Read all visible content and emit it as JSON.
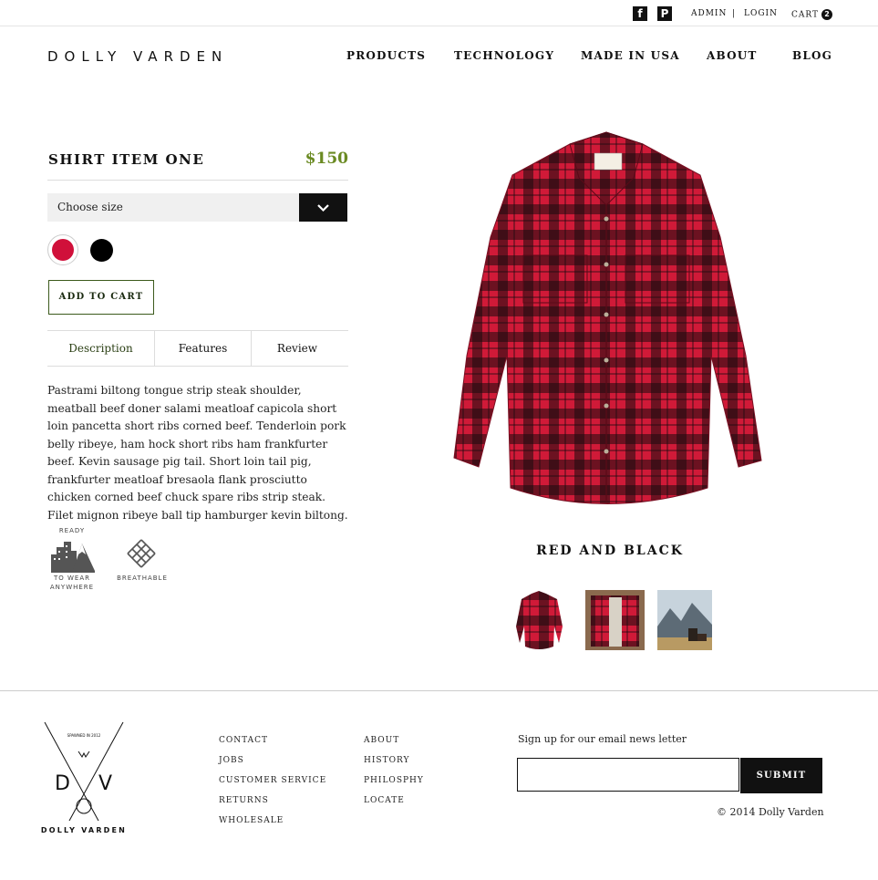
{
  "topbar": {
    "social": [
      {
        "name": "facebook",
        "glyph": "f"
      },
      {
        "name": "pinterest",
        "glyph": "P"
      }
    ],
    "admin": "ADMIN",
    "separator": "|",
    "login": "LOGIN",
    "cart": "CART",
    "cart_count": "2"
  },
  "header": {
    "brand": "DOLLY VARDEN",
    "nav": [
      "PRODUCTS",
      "TECHNOLOGY",
      "MADE IN USA",
      "ABOUT",
      "BLOG"
    ]
  },
  "product": {
    "title": "SHIRT ITEM ONE",
    "price": "$150",
    "size_placeholder": "Choose size",
    "swatches": [
      {
        "name": "red",
        "color": "#d0103a",
        "selected": true
      },
      {
        "name": "black",
        "color": "#000000",
        "selected": false
      }
    ],
    "add_to_cart": "ADD TO CART",
    "tabs": [
      "Description",
      "Features",
      "Review"
    ],
    "active_tab": "Description",
    "description": "Pastrami biltong tongue strip steak shoulder, meatball beef doner salami meatloaf capicola short loin pancetta short ribs corned beef. Tenderloin pork belly ribeye, ham hock short ribs ham frankfurter beef. Kevin sausage pig tail. Short loin tail pig, frankfurter meatloaf bresaola flank prosciutto chicken corned beef chuck spare ribs strip steak. Filet mignon ribeye ball tip hamburger kevin biltong.",
    "badges": {
      "ready": {
        "top": "READY",
        "line1": "TO WEAR",
        "line2": "ANYWHERE"
      },
      "breathable": "BREATHABLE"
    },
    "color_name": "RED AND BLACK",
    "thumbnails": [
      "shirt-front",
      "shirt-jacket",
      "outdoor-scene"
    ]
  },
  "footer": {
    "logo_brand": "DOLLY VARDEN",
    "links_col1": [
      "CONTACT",
      "JOBS",
      "CUSTOMER SERVICE",
      "RETURNS",
      "WHOLESALE"
    ],
    "links_col2": [
      "ABOUT",
      "HISTORY",
      "PHILOSPHY",
      "LOCATE"
    ],
    "signup_label": "Sign up for our email news letter",
    "email_placeholder": "",
    "submit": "SUBMIT",
    "copyright": "© 2014 Dolly Varden"
  },
  "colors": {
    "accent_green": "#6a8a22",
    "dark": "#111111",
    "shirt_red": "#c8102e"
  }
}
